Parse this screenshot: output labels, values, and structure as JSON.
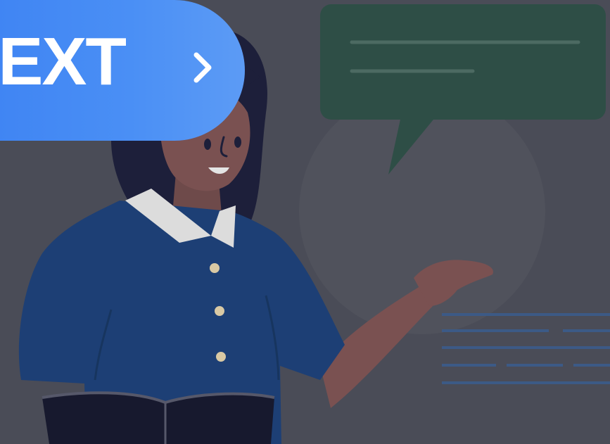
{
  "next_button": {
    "label": "NEXT",
    "chevron_icon": "chevron-right-icon"
  },
  "illustration": {
    "subject": "woman-presenting-icon",
    "speech_bubble_icon": "speech-bubble-icon",
    "book_icon": "open-book-icon"
  },
  "colors": {
    "background": "#4a4c57",
    "button_blue": "#4a8ff5",
    "speech_bubble_green": "#2e4e46",
    "shirt_blue": "#1d3f75"
  }
}
